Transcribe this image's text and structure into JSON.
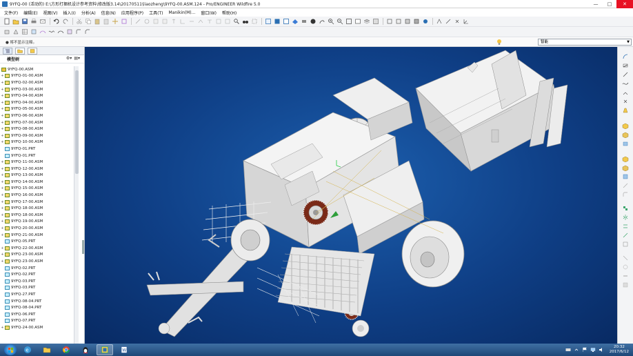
{
  "window": {
    "title": "9YFQ-00 (活动的) E:\\方形打捆机设计参考资料\\修改版3.14\\20170511\\liaozheng\\9YFQ-00.ASM.124 - Pro/ENGINEER Wildfire 5.0",
    "controls": [
      "—",
      "□",
      "✕"
    ]
  },
  "menu": {
    "items": [
      "文件(F)",
      "编辑(E)",
      "视图(V)",
      "插入(I)",
      "分析(A)",
      "信息(N)",
      "应用程序(P)",
      "工具(T)",
      "Manikin(M)...",
      "窗口(W)",
      "帮助(H)"
    ]
  },
  "status": {
    "message": "● 将不显示注释。",
    "filter_value": "智能"
  },
  "sidebar": {
    "header": "模型树",
    "header_tools": [
      "⚙▾",
      "▤▾"
    ],
    "tabs": [
      "模型树",
      "文件夹",
      "收藏夹"
    ],
    "items": [
      {
        "label": "9YFQ-00.ASM",
        "type": "root"
      },
      {
        "label": "9YFQ-01-00.ASM",
        "type": "asm"
      },
      {
        "label": "9YFQ-02-00.ASM",
        "type": "asm"
      },
      {
        "label": "9YFQ-03-00.ASM",
        "type": "asm"
      },
      {
        "label": "9YFQ-04-00.ASM",
        "type": "asm"
      },
      {
        "label": "9YFQ-04-00.ASM",
        "type": "asm"
      },
      {
        "label": "9YFQ-05-00.ASM",
        "type": "asm"
      },
      {
        "label": "9YFQ-06-00.ASM",
        "type": "asm"
      },
      {
        "label": "9YFQ-07-00.ASM",
        "type": "asm"
      },
      {
        "label": "9YFQ-08-00.ASM",
        "type": "asm"
      },
      {
        "label": "9YFQ-09-00.ASM",
        "type": "asm"
      },
      {
        "label": "9YFQ-10-00.ASM",
        "type": "asm"
      },
      {
        "label": "9YFQ-01.PRT",
        "type": "prt"
      },
      {
        "label": "9YFQ-01.PRT",
        "type": "prt"
      },
      {
        "label": "9YFQ-11-00.ASM",
        "type": "asm"
      },
      {
        "label": "9YFQ-12-00.ASM",
        "type": "asm"
      },
      {
        "label": "9YFQ-13-00.ASM",
        "type": "asm"
      },
      {
        "label": "9YFQ-14-00.ASM",
        "type": "asm"
      },
      {
        "label": "9YFQ-15-00.ASM",
        "type": "asm"
      },
      {
        "label": "9YFQ-16-00.ASM",
        "type": "asm"
      },
      {
        "label": "9YFQ-17-00.ASM",
        "type": "asm"
      },
      {
        "label": "9YFQ-18-00.ASM",
        "type": "asm"
      },
      {
        "label": "9YFQ-18-00.ASM",
        "type": "asm"
      },
      {
        "label": "9YFQ-19-00.ASM",
        "type": "asm"
      },
      {
        "label": "9YFQ-20-00.ASM",
        "type": "asm"
      },
      {
        "label": "9YFQ-21-00.ASM",
        "type": "asm"
      },
      {
        "label": "9YFQ-05.PRT",
        "type": "prt"
      },
      {
        "label": "9YFQ-22-00.ASM",
        "type": "asm"
      },
      {
        "label": "9YFQ-23-00.ASM",
        "type": "asm"
      },
      {
        "label": "9YFQ-23-00.ASM",
        "type": "asm"
      },
      {
        "label": "9YFQ-02.PRT",
        "type": "prt"
      },
      {
        "label": "9YFQ-02.PRT",
        "type": "prt"
      },
      {
        "label": "9YFQ-03.PRT",
        "type": "prt"
      },
      {
        "label": "9YFQ-03.PRT",
        "type": "prt"
      },
      {
        "label": "9YFQ-27.PRT",
        "type": "prt"
      },
      {
        "label": "9YFQ-08-04.PRT",
        "type": "prt"
      },
      {
        "label": "9YFQ-08-04.PRT",
        "type": "prt"
      },
      {
        "label": "9YFQ-06.PRT",
        "type": "prt"
      },
      {
        "label": "9YFQ-07.PRT",
        "type": "prt"
      },
      {
        "label": "9YFQ-24-00.ASM",
        "type": "asm"
      }
    ]
  },
  "taskbar": {
    "apps": [
      "windows-explorer-icon",
      "file-manager-icon",
      "chrome-icon",
      "qq-icon",
      "proe-icon",
      "word-icon"
    ],
    "clock_time": "20:32",
    "clock_date": "2017/6/12"
  },
  "colors": {
    "viewport_bg": "#0f3f86",
    "model_fill": "#ededed",
    "accent": "#1f6fc2"
  }
}
